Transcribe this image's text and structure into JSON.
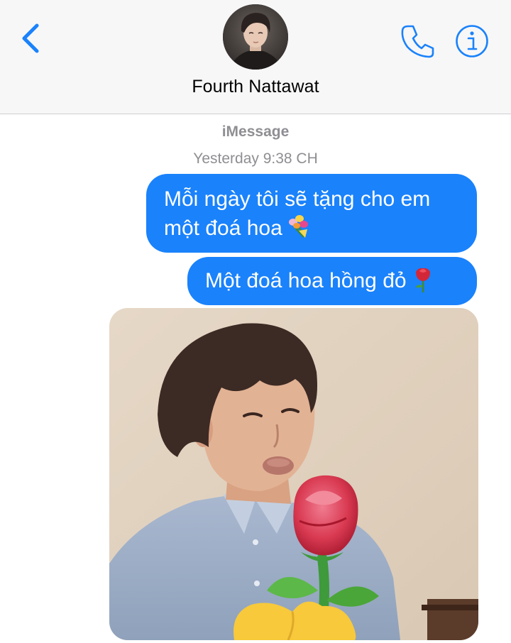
{
  "header": {
    "contact_name": "Fourth Nattawat",
    "back_icon": "chevron-left-icon",
    "call_icon": "phone-icon",
    "info_icon": "info-icon",
    "accent_color": "#1a82fb"
  },
  "conversation": {
    "service_label": "iMessage",
    "timestamp": "Yesterday 9:38 CH",
    "messages": [
      {
        "direction": "outgoing",
        "text_line1": "Mỗi ngày tôi sẽ tặng cho em",
        "text_line2": "một đoá hoa",
        "emoji": "bouquet-icon"
      },
      {
        "direction": "outgoing",
        "text": "Một đoá hoa hồng đỏ",
        "emoji": "rose-icon"
      },
      {
        "direction": "outgoing",
        "type": "photo",
        "content": "man-holding-rose-photo"
      }
    ],
    "bubble_color": "#1a82fb"
  }
}
